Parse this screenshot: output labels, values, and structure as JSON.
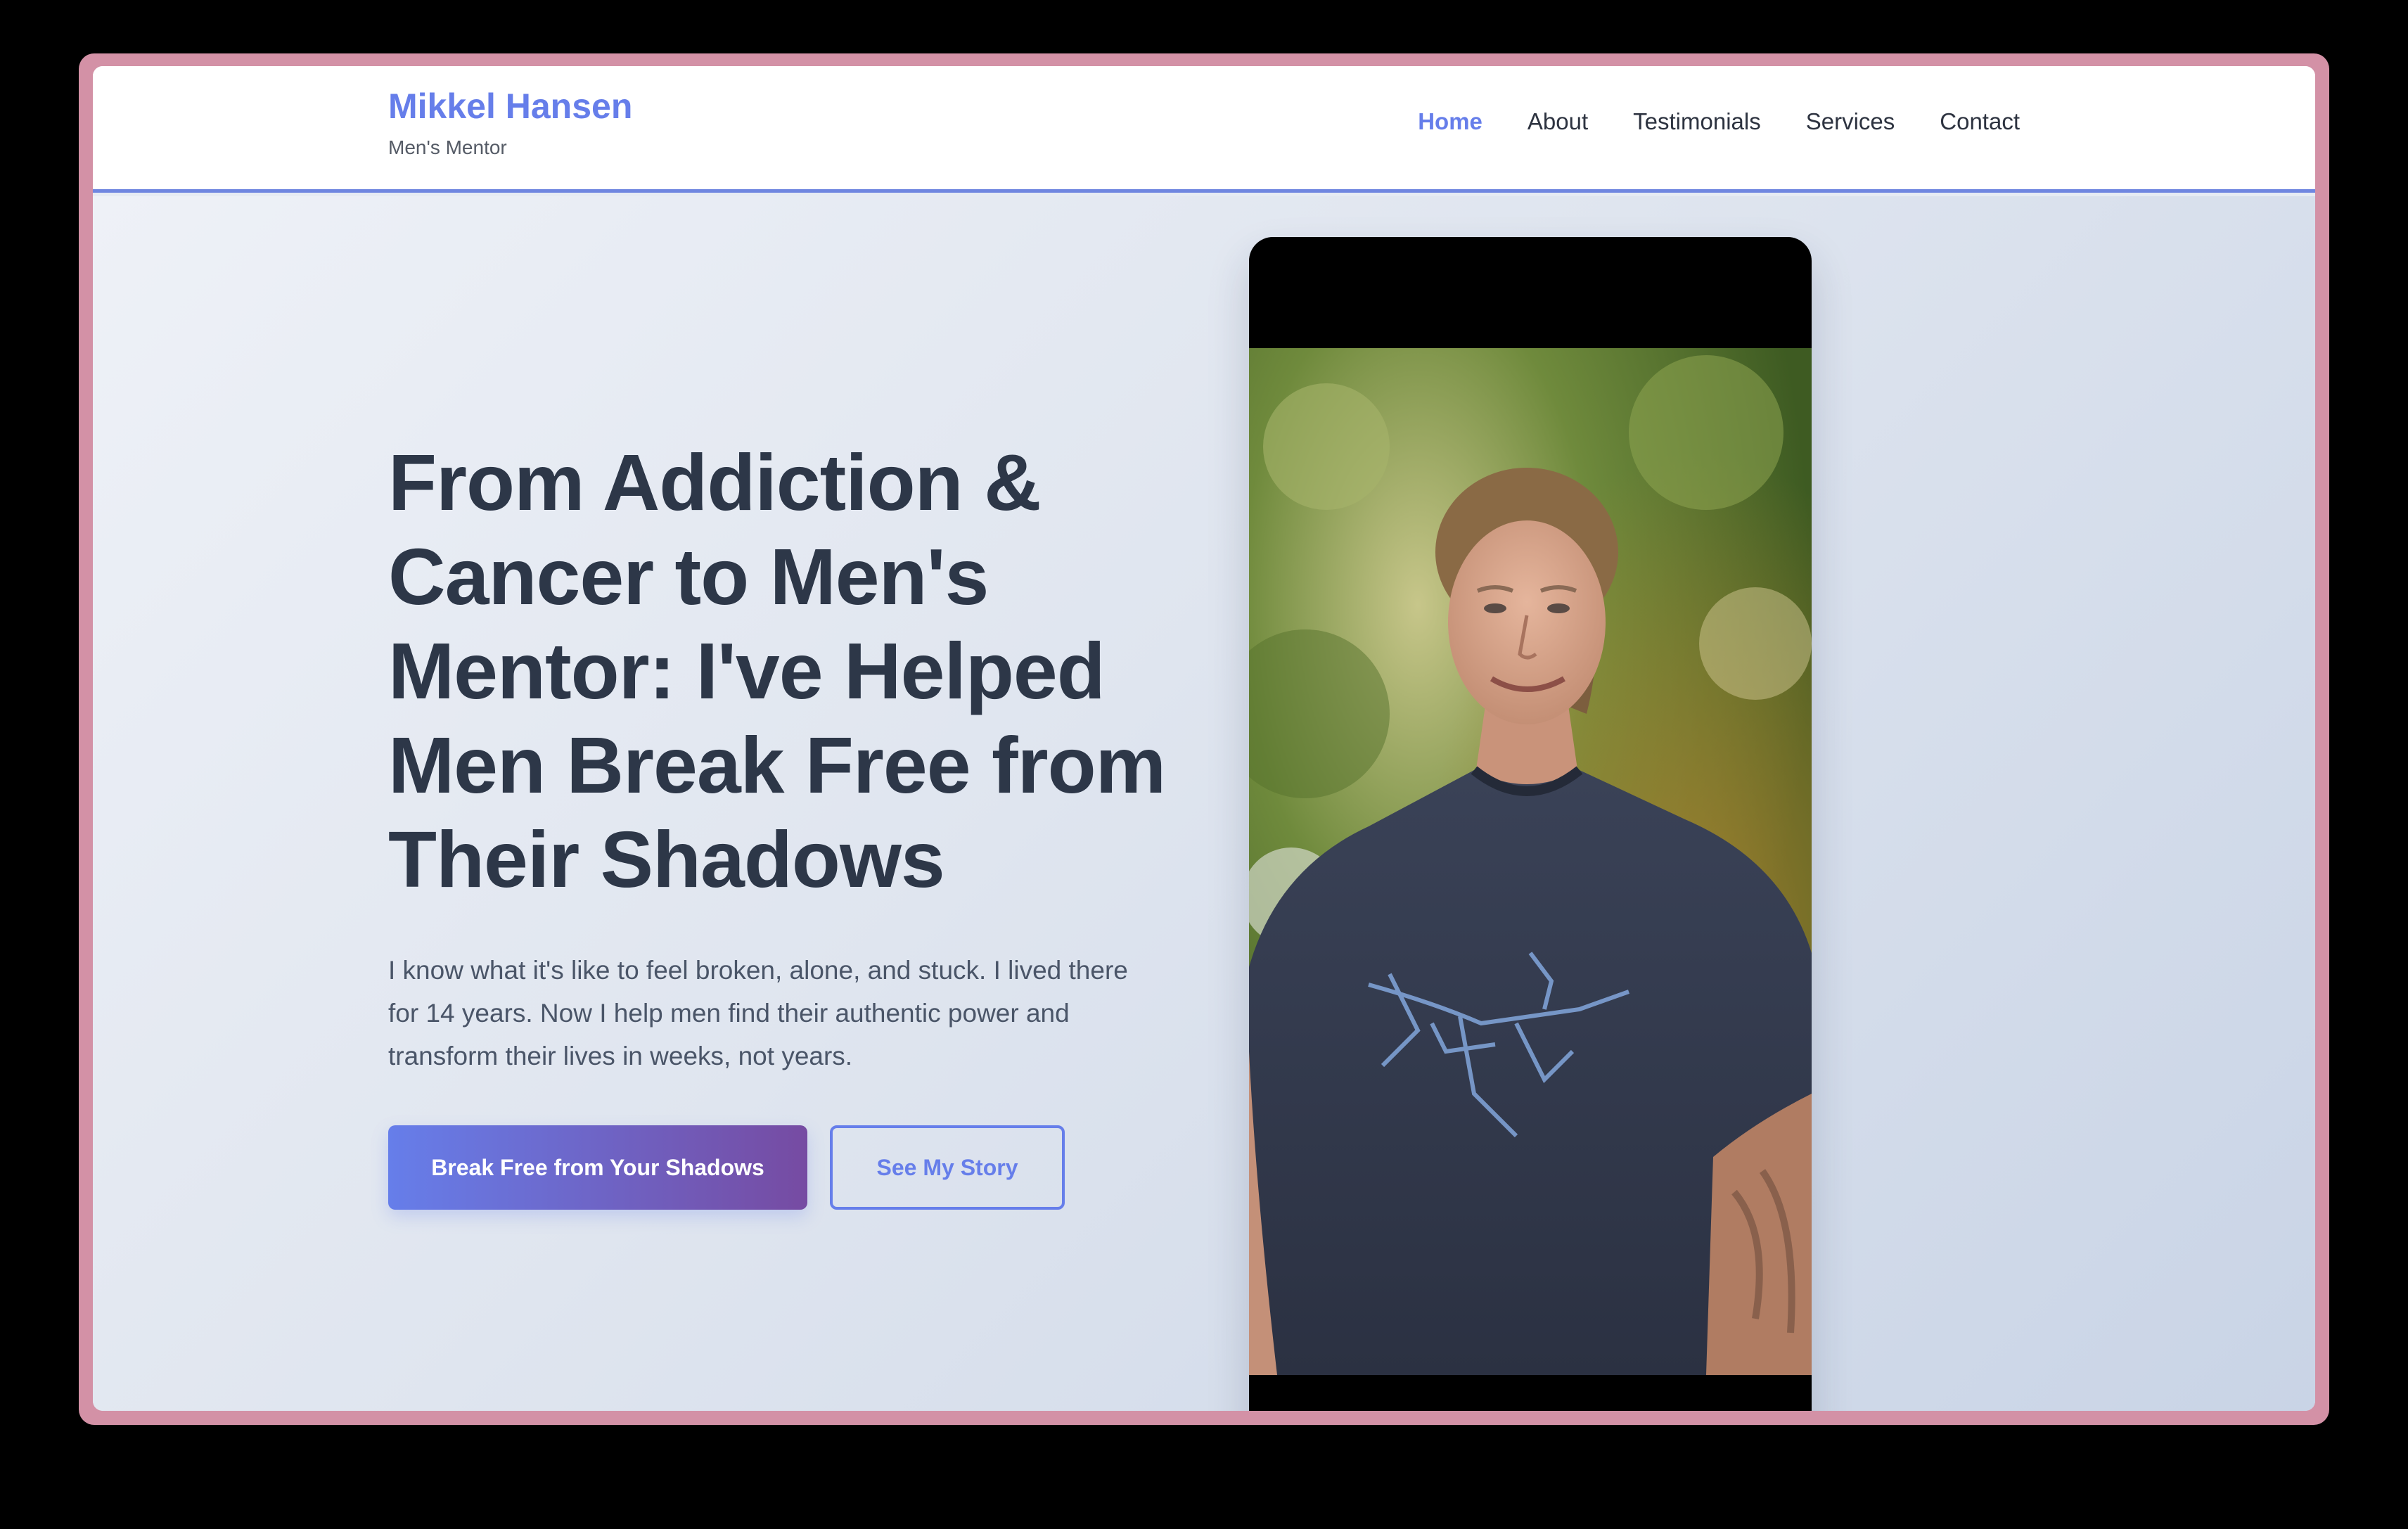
{
  "header": {
    "brand_name": "Mikkel Hansen",
    "brand_tagline": "Men's Mentor",
    "nav": [
      {
        "label": "Home",
        "active": true
      },
      {
        "label": "About",
        "active": false
      },
      {
        "label": "Testimonials",
        "active": false
      },
      {
        "label": "Services",
        "active": false
      },
      {
        "label": "Contact",
        "active": false
      }
    ]
  },
  "hero": {
    "title": "From Addiction & Cancer to Men's Mentor: I've Helped Men Break Free from Their Shadows",
    "subtitle": "I know what it's like to feel broken, alone, and stuck. I lived there for 14 years. Now I help men find their authentic power and transform their lives in weeks, not years.",
    "primary_cta": "Break Free from Your Shadows",
    "secondary_cta": "See My Story"
  },
  "colors": {
    "accent": "#667eea",
    "accent_end": "#764ba2",
    "heading": "#2d3748",
    "body_text": "#4a5568",
    "window_frame": "#d391a6"
  },
  "icons": {
    "photo": "portrait-photo"
  }
}
